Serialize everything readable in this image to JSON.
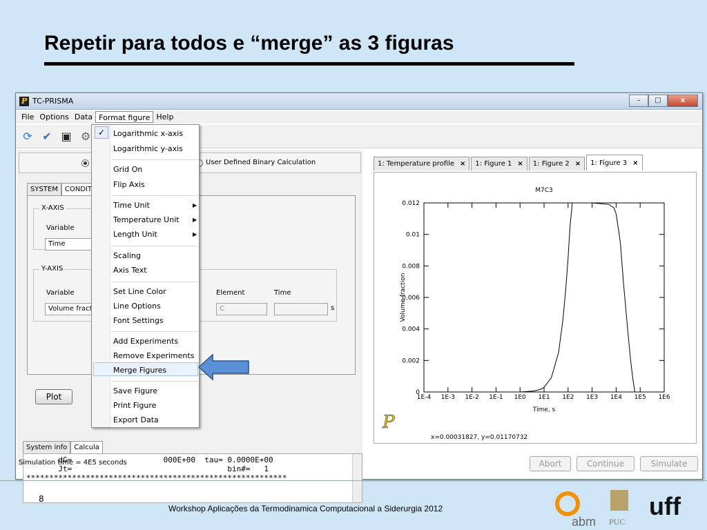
{
  "slide": {
    "title": "Repetir para todos e “merge” as 3 figuras",
    "page_number": "8",
    "footer": "Workshop Aplicações da Termodinamica Computacional a Siderurgia 2012",
    "logos": {
      "abm": "abm",
      "puc": "PUC",
      "uff": "uff"
    }
  },
  "window": {
    "title": "TC-PRISMA",
    "app_icon": "P",
    "controls": {
      "minimize": "–",
      "maximize": "□",
      "close": "x"
    }
  },
  "menubar": [
    "File",
    "Options",
    "Data",
    "Format figure",
    "Help"
  ],
  "toolbar_icons": [
    "refresh-icon",
    "check-icon",
    "save-icon",
    "gear-icon"
  ],
  "calc_mode": {
    "partial_label": "C",
    "other_option": "User Defined Binary Calculation"
  },
  "left_tabs": [
    "SYSTEM",
    "CONDITI"
  ],
  "x_axis": {
    "legend": "X-AXIS",
    "variable_label": "Variable",
    "variable_value": "Time"
  },
  "y_axis": {
    "legend": "Y-AXIS",
    "variable_label": "Variable",
    "variable_value": "Volume fractio",
    "element_label": "Element",
    "element_value": "C",
    "time_label": "Time",
    "time_unit": "s"
  },
  "plot_button": "Plot",
  "console_tabs": [
    "System info",
    "Calcula"
  ],
  "console_lines": [
    "       dG=                    000E+00  tau= 0.0000E+00",
    "       Jt=                                  bin#=   1",
    "*********************************************************"
  ],
  "status_text": "Simulation time = 4E5 seconds",
  "figure_tabs": [
    {
      "label": "1: Temperature profile",
      "close": "×"
    },
    {
      "label": "1: Figure 1",
      "close": "×"
    },
    {
      "label": "1: Figure 2",
      "close": "×"
    },
    {
      "label": "1: Figure 3",
      "close": "×",
      "selected": true
    }
  ],
  "buttons": {
    "abort": "Abort",
    "continue": "Continue",
    "simulate": "Simulate"
  },
  "format_menu": [
    {
      "label": "Logarithmic x-axis",
      "checked": true
    },
    {
      "label": "Logarithmic y-axis"
    },
    {
      "label": "Grid On"
    },
    {
      "label": "Flip Axis"
    },
    {
      "label": "Time Unit",
      "submenu": true
    },
    {
      "label": "Temperature Unit",
      "submenu": true
    },
    {
      "label": "Length Unit",
      "submenu": true
    },
    {
      "label": "Scaling"
    },
    {
      "label": "Axis Text"
    },
    {
      "label": "Set Line Color"
    },
    {
      "label": "Line Options"
    },
    {
      "label": "Font Settings"
    },
    {
      "label": "Add Experiments"
    },
    {
      "label": "Remove Experiments"
    },
    {
      "label": "Merge Figures",
      "highlighted": true
    },
    {
      "label": "Save Figure"
    },
    {
      "label": "Print Figure"
    },
    {
      "label": "Export Data"
    }
  ],
  "annotation_color": "#5b8fd6",
  "chart_data": {
    "type": "line",
    "title": "M7C3",
    "xlabel": "Time, s",
    "ylabel": "Volume fraction",
    "x_scale": "log",
    "x_ticks": [
      "1E-4",
      "1E-3",
      "1E-2",
      "1E-1",
      "1E0",
      "1E1",
      "1E2",
      "1E3",
      "1E4",
      "1E5",
      "1E6"
    ],
    "y_ticks": [
      "0",
      "0.002",
      "0.004",
      "0.006",
      "0.008",
      "0.01",
      "0.012"
    ],
    "ylim": [
      0,
      0.012
    ],
    "xlim_exp": [
      -4,
      6
    ],
    "series": [
      {
        "x": [
          0.1,
          1,
          3,
          5,
          8,
          10,
          20,
          40,
          60,
          80,
          100,
          120,
          150,
          1000,
          5000,
          8000,
          10000,
          15000,
          20000,
          30000,
          40000,
          50000,
          60000
        ],
        "y": [
          0,
          0,
          5e-05,
          0.0001,
          0.0002,
          0.0003,
          0.0009,
          0.0025,
          0.0045,
          0.0065,
          0.0085,
          0.0105,
          0.012,
          0.012,
          0.0119,
          0.0117,
          0.0113,
          0.0095,
          0.007,
          0.004,
          0.002,
          0.0008,
          0
        ]
      }
    ],
    "readout": "x=0.00031827, y=0.01170732",
    "grid": false,
    "logo_mark": "P"
  }
}
